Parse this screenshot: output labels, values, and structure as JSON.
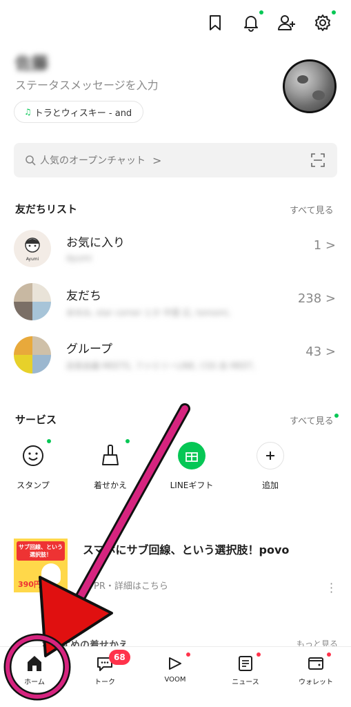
{
  "header": {
    "icons": [
      "bookmark-icon",
      "bell-icon",
      "add-friend-icon",
      "settings-icon"
    ]
  },
  "profile": {
    "name": "佐藤",
    "status_placeholder": "ステータスメッセージを入力",
    "music": "トラとウィスキー - and"
  },
  "search": {
    "placeholder": "人気のオープンチャット",
    "chevron": ">"
  },
  "friends": {
    "title": "友だちリスト",
    "see_all": "すべて見る",
    "rows": [
      {
        "label": "お気に入り",
        "sub": "Ayumi",
        "count": "1"
      },
      {
        "label": "友だち",
        "sub": "あゆみ, star corner とか 中里 広, tomomi,",
        "count": "238"
      },
      {
        "label": "グループ",
        "sub": "店長会議 MEETS, ファミリーLINE, CSS 会 MEET,",
        "count": "43"
      }
    ],
    "chevron": ">"
  },
  "services": {
    "title": "サービス",
    "see_all": "すべて見る",
    "items": [
      {
        "label": "スタンプ",
        "icon": "sticker-icon"
      },
      {
        "label": "着せかえ",
        "icon": "theme-brush-icon"
      },
      {
        "label": "LINEギフト",
        "icon": "gift-icon"
      },
      {
        "label": "追加",
        "icon": "plus-icon"
      }
    ]
  },
  "banner": {
    "title": "スマホにサブ回線、という選択肢！povo",
    "sub": "PR・詳細はこちら",
    "image_text": "サブ回線、という選択肢！",
    "price": "390円"
  },
  "recommend": {
    "title": "おすすめの着せかえ",
    "more": "もっと見る"
  },
  "bottom_nav": {
    "items": [
      {
        "label": "ホーム",
        "icon": "home-icon"
      },
      {
        "label": "トーク",
        "icon": "chat-icon",
        "badge": "68"
      },
      {
        "label": "VOOM",
        "icon": "voom-icon"
      },
      {
        "label": "ニュース",
        "icon": "news-icon"
      },
      {
        "label": "ウォレット",
        "icon": "wallet-icon"
      }
    ]
  },
  "colors": {
    "accent_green": "#06c755",
    "badge_red": "#ff334b",
    "annotation_red": "#e01010",
    "annotation_magenta": "#d6247f"
  }
}
